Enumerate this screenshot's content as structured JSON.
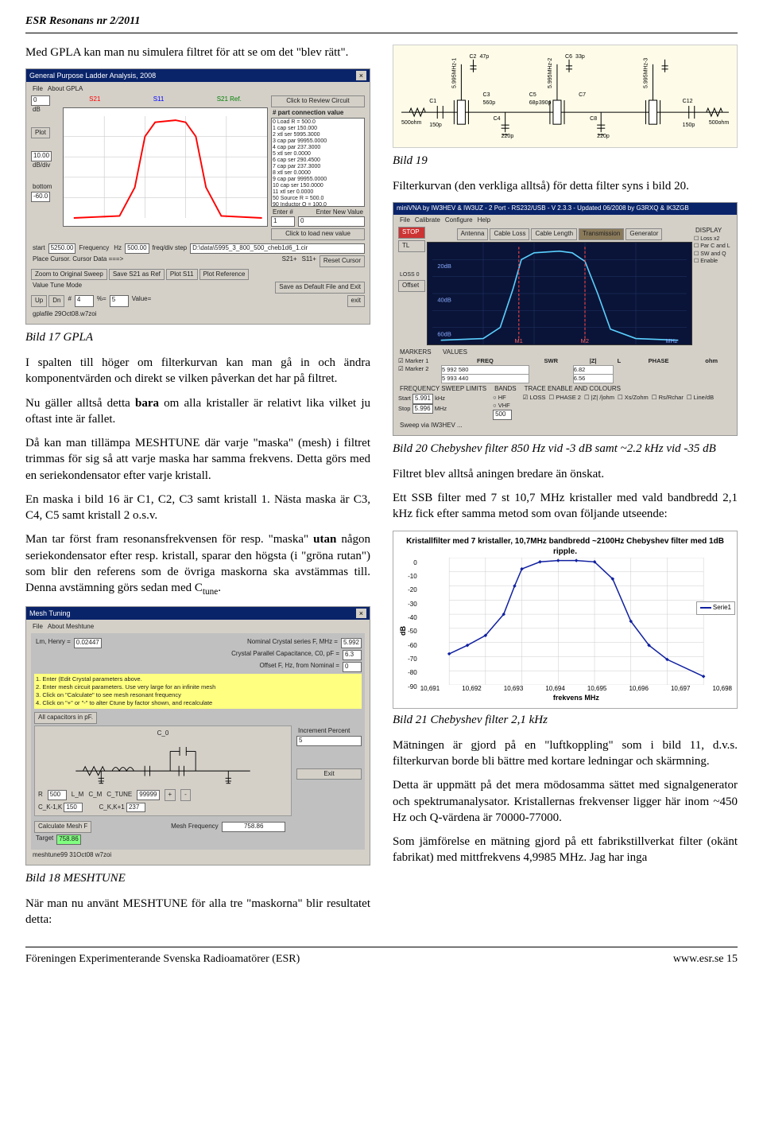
{
  "header": {
    "publication": "ESR Resonans nr 2/2011"
  },
  "left": {
    "intro": "Med GPLA kan man nu simulera filtret för att se om det \"blev rätt\".",
    "caption17": "Bild 17 GPLA",
    "p1": "I spalten till höger om filterkurvan kan man gå in och ändra komponentvärden och direkt se vilken påverkan det har på filtret.",
    "p2_a": "Nu gäller alltså detta ",
    "p2_b": "bara",
    "p2_c": " om alla kristaller är relativt lika vilket ju oftast inte är fallet.",
    "p3": "Då kan man tillämpa MESHTUNE där varje \"maska\" (mesh) i filtret trimmas för sig så att varje maska har samma frekvens. Detta görs med en seriekondensator efter varje kristall.",
    "p4": "En maska i bild 16 är C1, C2, C3 samt kristall 1. Nästa maska är C3, C4, C5 samt kristall 2 o.s.v.",
    "p5_a": "Man tar först fram resonansfrekvensen för resp. \"maska\" ",
    "p5_b": "utan",
    "p5_c": " någon seriekondensator efter resp. kristall, sparar den högsta (i \"gröna rutan\") som blir den referens som de övriga maskorna ska avstämmas till. Denna avstämning görs sedan med C",
    "p5_d": "tune",
    "p5_e": ".",
    "caption18": "Bild 18 MESHTUNE",
    "p6": "När man nu använt MESHTUNE för alla tre \"maskorna\" blir resultatet detta:"
  },
  "right": {
    "caption19": "Bild 19",
    "p1": "Filterkurvan (den verkliga alltså) för detta filter syns i bild 20.",
    "caption20": "Bild 20  Chebyshev filter 850 Hz vid -3 dB samt ~2.2 kHz vid -35 dB",
    "p2": "Filtret blev alltså aningen bredare än önskat.",
    "p3": "Ett SSB filter med 7 st 10,7 MHz kristaller med vald bandbredd 2,1 kHz fick efter samma metod som ovan följande utseende:",
    "caption21": "Bild 21 Chebyshev filter 2,1 kHz",
    "p4": "Mätningen är gjord på en \"luftkoppling\" som i bild 11, d.v.s. filterkurvan borde bli bättre med kortare ledningar och skärmning.",
    "p5": "Detta är uppmätt på det mera mödosamma sättet med signalgenerator och spektrumanalysator. Kristallernas frekvenser ligger här inom ~450 Hz och Q-värdena är 70000-77000.",
    "p6": "Som jämförelse en mätning gjord på ett fabrikstillverkat filter (okänt fabrikat) med mittfrekvens 4,9985 MHz. Jag har inga"
  },
  "gpla": {
    "title": "General Purpose Ladder Analysis, 2008",
    "menu_file": "File",
    "menu_about": "About GPLA",
    "partslist_head": "#  part  connection  value",
    "review_btn": "Click to Review Circuit",
    "loadnew_btn": "Click to load new value",
    "enter_n": "Enter #",
    "enter_val": "Enter New Value",
    "plot": "Plot",
    "db_div": "dB/div",
    "bottom": "bottom",
    "start": "start",
    "freq_label": "Frequency",
    "freq_hz": "Hz",
    "freq_step": "freq/div step",
    "cursor": "Place Cursor. Cursor Data ===>",
    "zoom": "Zoom to Original Sweep",
    "save_s21": "Save S21 as Ref",
    "plot_s11": "Plot S11",
    "plot_ref": "Plot Reference",
    "reset_cursor": "Reset Cursor",
    "save_exit": "Save as Default File and Exit",
    "exit": "exit",
    "value_tune": "Value Tune Mode",
    "up": "Up",
    "dn": "Dn",
    "num_sym": "#",
    "pct_sym": "%=",
    "value_sym": "Value=",
    "s21_lbl": "S21",
    "s11_lbl": "S11",
    "s21ref_lbl": "S21 Ref.",
    "s21p_lbl": "S21+",
    "s11p_lbl": "S11+",
    "val_db0": "0",
    "val_db": "dB",
    "val_dbdiv": "10.00",
    "val_bottom": "-60.0",
    "val_start": "5250.00",
    "val_step": "500.00",
    "enter_n_val": "1",
    "enter_val_val": "0",
    "vt_num": "4",
    "vt_pct": "5",
    "filename": "gplafile 29Oct08.w7zoi",
    "filepath": "D:\\data\\5995_3_800_500_cheb1d6_1.cir"
  },
  "gpla_parts": [
    "0 Load R = 500.0",
    "1 cap ser 150.000",
    "2 xtl ser 5995.3000",
    "3 cap par 99955.0000",
    "4 cap par 237.3000",
    "5 xtl ser 0.0000",
    "6 cap ser 290.4500",
    "7 cap par 237.3000",
    "8 xtl ser 0.0000",
    "9 cap par 99955.0000",
    "10 cap ser 150.0000",
    "11 xtl ser 0.0000",
    "50 Source R = 500.0",
    "90 Inductor Q = 100.0"
  ],
  "schematic_labels": {
    "l1": "500ohm",
    "c1": "C1 150p",
    "c2": "C2 47p",
    "c3": "C3 560p",
    "c4": "C4 220p",
    "x1": "5.995MHz-1",
    "c5": "C5 68p",
    "c6_add": "390p",
    "x2": "5.995MHz-2",
    "c6": "C6 33p",
    "c7": "C7",
    "c8": "C8 220p",
    "x3": "5.995MHz-3",
    "c12": "C12 150p",
    "l2": "500ohm"
  },
  "meshtune": {
    "title": "Mesh Tuning",
    "menu_file": "File",
    "menu_about": "About Meshtune",
    "lm_label": "Lm, Henry =",
    "lm_val": "0.02447",
    "f_label": "Nominal Crystal series F, MHz =",
    "f_val": "5.992",
    "cd_label": "Crystal Parallel Capacitance, C0, pF =",
    "cd_val": "6.3",
    "off_label": "Offset F, Hz, from Nominal =",
    "off_val": "0",
    "step1": "1. Enter (Edit Crystal parameters above.",
    "step2": "2. Enter mesh circuit parameters. Use very large for an infinite mesh",
    "step3": "3. Click on \"Calculate\" to see mesh resonant frequency",
    "step4": "4. Click on \"+\" or \"-\" to alter Ctune by factor shown, and recalculate",
    "all_caps": "All capacitors in pF.",
    "inc_label": "Increment Percent",
    "inc_val": "5",
    "r_val": "500",
    "lm_sym": "L_M",
    "cm_sym": "C_M",
    "c0_sym": "C_0",
    "ctune_sym": "C_TUNE",
    "ck1_sym": "C_K-1,K",
    "ck1_val": "150",
    "ck2_sym": "C_K,K+1",
    "ck2_val": "237",
    "plus": "+",
    "minus": "-",
    "ctune_val": "99999",
    "calc_btn": "Calculate Mesh F",
    "mesh_freq_lbl": "Mesh Frequency",
    "mesh_freq_val": "758.86",
    "target_lbl": "Target",
    "target_val": "758.86",
    "exit": "Exit",
    "filename": "meshtune99 31Oct08 w7zoi"
  },
  "vna": {
    "title": "miniVNA by IW3HEV & IW3UZ - 2 Port - RS232/USB - V 2.3.3 - Updated 06/2008 by G3RXQ & IK3ZGB",
    "menu_file": "File",
    "menu_cal": "Calibrate",
    "menu_conf": "Configure",
    "menu_help": "Help",
    "mode1": "Antenna",
    "mode2": "Cable Loss",
    "mode3": "Cable Length",
    "mode4": "Transmission",
    "mode5": "Generator",
    "stop": "STOP",
    "tl": "TL",
    "loss0": "LOSS 0",
    "offset": "Offset",
    "markers_lbl": "MARKERS",
    "values_lbl": "VALUES",
    "mk1": "Marker 1",
    "mk2": "Marker 2",
    "freq_h": "FREQ",
    "swr_h": "SWR",
    "z_h": "|Z|",
    "l_h": "L",
    "phase_h": "PHASE",
    "ohm_h": "ohm",
    "mk1_freq": "5 992 580",
    "mk1_z": "6.82",
    "mk2_freq": "5 993 440",
    "mk2_z": "6.56",
    "fsl": "FREQUENCY SWEEP LIMITS",
    "bands": "BANDS",
    "tec": "TRACE ENABLE AND COLOURS",
    "start_l": "Start",
    "start_v": "5.991",
    "khz": "kHz",
    "stop_l": "Stop",
    "stop_v": "5.996",
    "mhz": "MHz",
    "hf": "HF",
    "vhf": "VHF",
    "samples": "500",
    "display": "DISPLAY",
    "lossx2": "Loss x2",
    "par": "Par C and L",
    "sw_q": "SW and Q",
    "enable": "Enable",
    "loss_t": "LOSS",
    "phase_t": "PHASE 2",
    "z_t": "|Z| /|ohm",
    "xs_t": "Xs/Zohm",
    "rs_t": "Rs/Rchar",
    "line": "Line/dB",
    "stat": "Sweep via IW3HEV ..."
  },
  "chart_data": {
    "type": "line",
    "title": "Kristallfilter med 7 kristaller, 10,7MHz bandbredd ~2100Hz Chebyshev filter med 1dB ripple.",
    "xlabel": "frekvens MHz",
    "ylabel": "dB",
    "legend": "Serie1",
    "xticks": [
      10.691,
      10.692,
      10.693,
      10.694,
      10.695,
      10.696,
      10.697,
      10.698
    ],
    "yticks": [
      0,
      -10,
      -20,
      -30,
      -40,
      -50,
      -60,
      -70,
      -80,
      -90
    ],
    "ylim": [
      -90,
      0
    ],
    "series": [
      {
        "name": "Serie1",
        "x": [
          10.691,
          10.6915,
          10.692,
          10.6925,
          10.6928,
          10.693,
          10.6935,
          10.694,
          10.6945,
          10.695,
          10.6955,
          10.696,
          10.6965,
          10.697,
          10.698
        ],
        "y": [
          -68,
          -62,
          -55,
          -40,
          -20,
          -8,
          -3,
          -2,
          -2,
          -3,
          -15,
          -45,
          -62,
          -72,
          -84
        ]
      }
    ]
  },
  "chart21_axis": {
    "x0": "10,691",
    "x1": "10,692",
    "x2": "10,693",
    "x3": "10,694",
    "x4": "10,695",
    "x5": "10,696",
    "x6": "10,697",
    "x7": "10,698",
    "y0": "0",
    "y1": "-10",
    "y2": "-20",
    "y3": "-30",
    "y4": "-40",
    "y5": "-50",
    "y6": "-60",
    "y7": "-70",
    "y8": "-80",
    "y9": "-90"
  },
  "footer": {
    "left": "Föreningen Experimenterande Svenska Radioamatörer (ESR)",
    "right_a": "www.esr.se ",
    "right_b": "15"
  }
}
